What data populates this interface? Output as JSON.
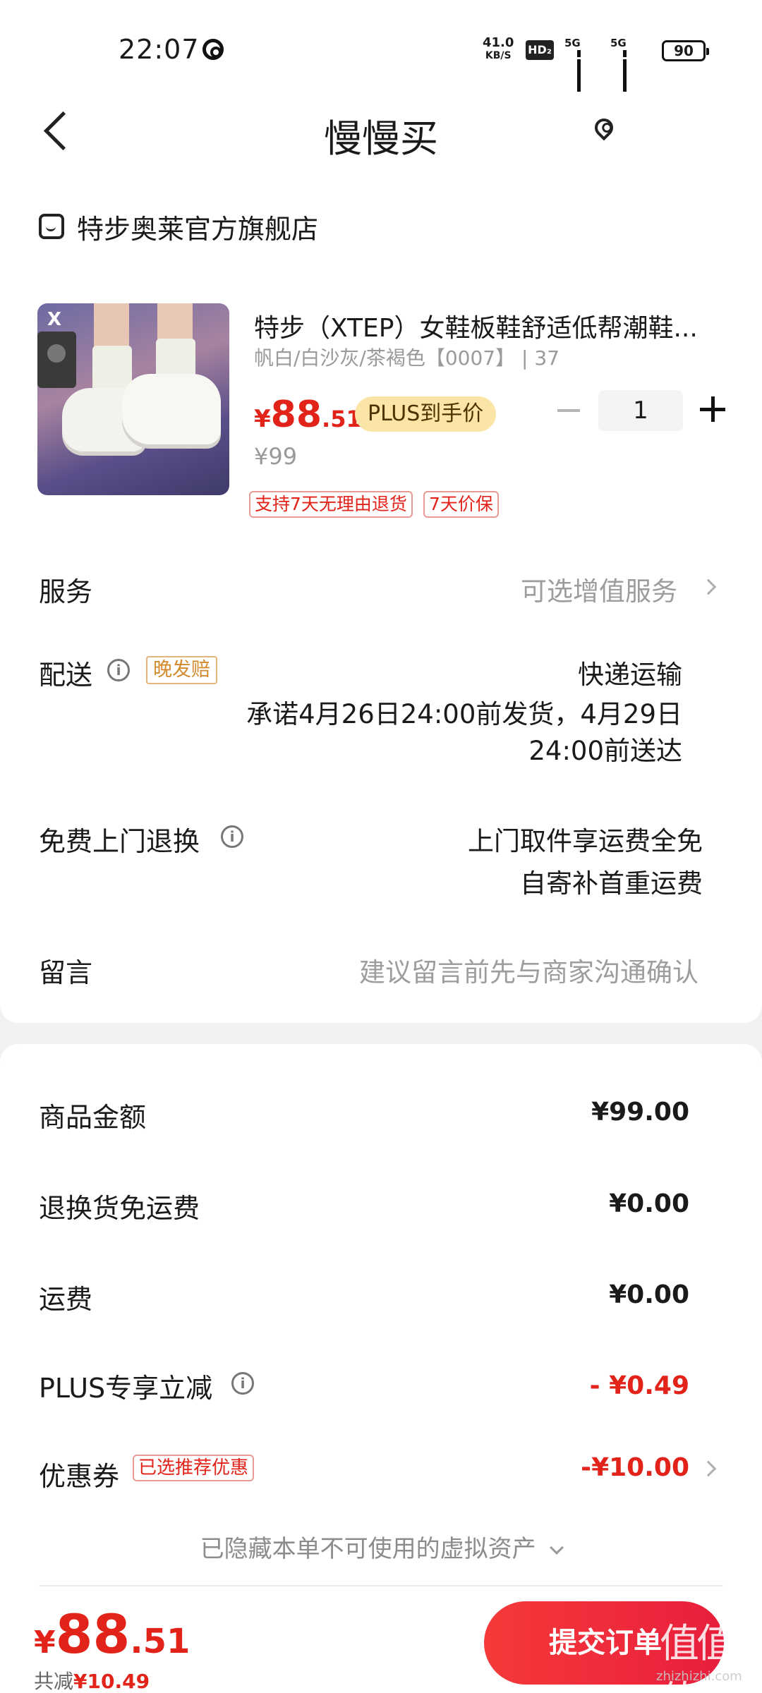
{
  "status_bar": {
    "time": "22:07",
    "net_speed": "41.0",
    "net_unit": "KB/S",
    "hd": "HD₂",
    "sim1": "5G",
    "sim2": "5G",
    "battery": "90"
  },
  "header": {
    "title": "慢慢买"
  },
  "store": {
    "name": "特步奥莱官方旗舰店"
  },
  "product": {
    "name": "特步（XTEP）女鞋板鞋舒适低帮潮鞋...",
    "spec": "帆白/白沙灰/茶褐色【0007】 | 37",
    "price_symbol": "¥",
    "price_int": "88",
    "price_dec": ".51",
    "plus_tag": "PLUS到手价",
    "original_price": "¥99",
    "quantity": "1",
    "tags": [
      "支持7天无理由退货",
      "7天价保"
    ]
  },
  "service": {
    "label": "服务",
    "value": "可选增值服务"
  },
  "delivery": {
    "label": "配送",
    "late_tag": "晚发赔",
    "method": "快递运输",
    "promise_line1": "承诺4月26日24:00前发货，4月29日",
    "promise_line2": "24:00前送达"
  },
  "return": {
    "label": "免费上门退换",
    "line1": "上门取件享运费全免",
    "line2": "自寄补首重运费"
  },
  "message": {
    "label": "留言",
    "placeholder": "建议留言前先与商家沟通确认"
  },
  "summary": {
    "items": [
      {
        "label": "商品金额",
        "value": "¥99.00"
      },
      {
        "label": "退换货免运费",
        "value": "¥0.00"
      },
      {
        "label": "运费",
        "value": "¥0.00"
      },
      {
        "label": "PLUS专享立减",
        "value": "- ¥0.49"
      },
      {
        "label": "优惠券",
        "value": "-¥10.00"
      }
    ],
    "coupon_tag": "已选推荐优惠",
    "hidden_assets": "已隐藏本单不可使用的虚拟资产"
  },
  "bottom": {
    "total_symbol": "¥",
    "total_int": "88",
    "total_dec": ".51",
    "reduce_label": "共减",
    "reduce_value": "¥10.49",
    "submit": "提交订单"
  },
  "watermark": {
    "logo": "值值值",
    "site": "zhizhizhi.com"
  },
  "colors": {
    "accent_red": "#e2231a",
    "plus_gold": "#fbe5a6",
    "late_tag_orange": "#d28a2d"
  }
}
